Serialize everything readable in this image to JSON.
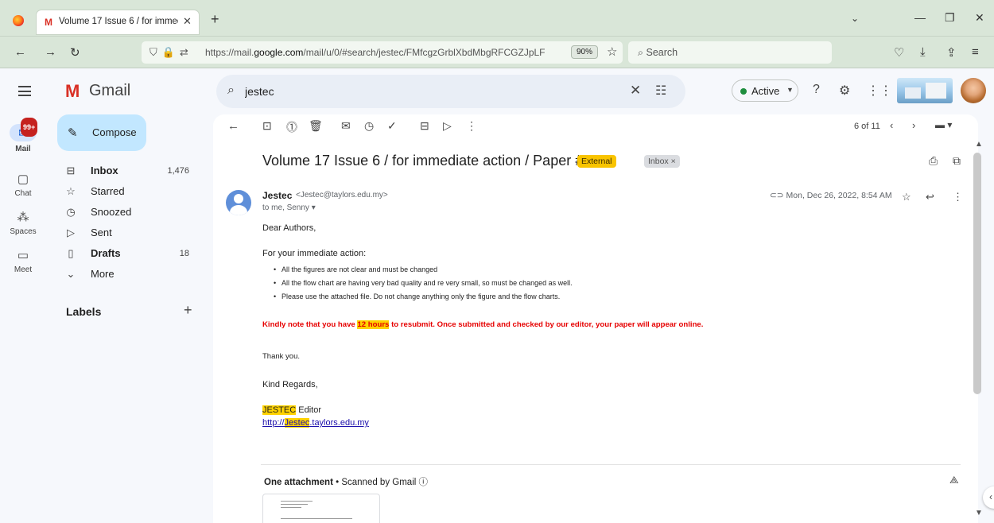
{
  "browser": {
    "tab_title": "Volume 17 Issue 6 / for immedia",
    "tab_close": "✕",
    "new_tab": "+",
    "url_prefix": "https://mail.",
    "url_host": "google.com",
    "url_path": "/mail/u/0/#search/jestec/FMfcgzGrblXbdMbgRFCGZJpLF",
    "zoom": "90%",
    "search_placeholder": "Search",
    "icons": [
      "firefox-logo",
      "gmail-tab-icon",
      "back-icon",
      "forward-icon",
      "reload-icon",
      "shield-icon",
      "lock-icon",
      "permissions-icon",
      "bookmark-star-icon",
      "pocket-icon",
      "download-icon",
      "share-icon",
      "menu-icon"
    ]
  },
  "gmail": {
    "app_name": "Gmail",
    "search_value": "jestec",
    "status": "Active",
    "mail_badge": "99+"
  },
  "rail": [
    {
      "label": "Mail",
      "icon": "mail-icon"
    },
    {
      "label": "Chat",
      "icon": "chat-icon"
    },
    {
      "label": "Spaces",
      "icon": "spaces-icon"
    },
    {
      "label": "Meet",
      "icon": "meet-icon"
    }
  ],
  "compose_label": "Compose",
  "folders": [
    {
      "label": "Inbox",
      "count": "1,476",
      "icon": "inbox-icon",
      "bold": true
    },
    {
      "label": "Starred",
      "count": "",
      "icon": "star-icon",
      "bold": false
    },
    {
      "label": "Snoozed",
      "count": "",
      "icon": "clock-icon",
      "bold": false
    },
    {
      "label": "Sent",
      "count": "",
      "icon": "send-icon",
      "bold": false
    },
    {
      "label": "Drafts",
      "count": "18",
      "icon": "draft-icon",
      "bold": true
    },
    {
      "label": "More",
      "count": "",
      "icon": "chevron-down-icon",
      "bold": false
    }
  ],
  "labels_title": "Labels",
  "toolbar": {
    "pager": "6 of 11"
  },
  "email": {
    "subject": "Volume 17 Issue 6 / for immediate action / Paper #13",
    "tag_external": "External",
    "tag_inbox": "Inbox ×",
    "sender_name": "Jestec",
    "sender_email": "<Jestec@taylors.edu.my>",
    "to_line": "to me, Senny ▾",
    "date": "Mon, Dec 26, 2022, 8:54 AM",
    "greeting": "Dear Authors,",
    "intro": "For your immediate action:",
    "bullets": [
      "All the figures are not clear and must be changed",
      "All the flow chart are having very bad quality and re very small, so must be changed as well.",
      "Please use the attached file. Do not change anything only the figure and the flow charts."
    ],
    "note_before": "Kindly note that you have ",
    "note_highlight": "12 hours",
    "note_after": " to resubmit. Once submitted and checked by our editor, your paper will appear online.",
    "thanks": "Thank you.",
    "regards": "Kind Regards,",
    "sig_name_hl": "JESTEC",
    "sig_name_rest": " Editor",
    "sig_link_before": "http://",
    "sig_link_hl": "Jestec",
    "sig_link_after": ".taylors.edu.my",
    "attachment_title": "One attachment",
    "attachment_scan": " • Scanned by Gmail ⓘ"
  }
}
